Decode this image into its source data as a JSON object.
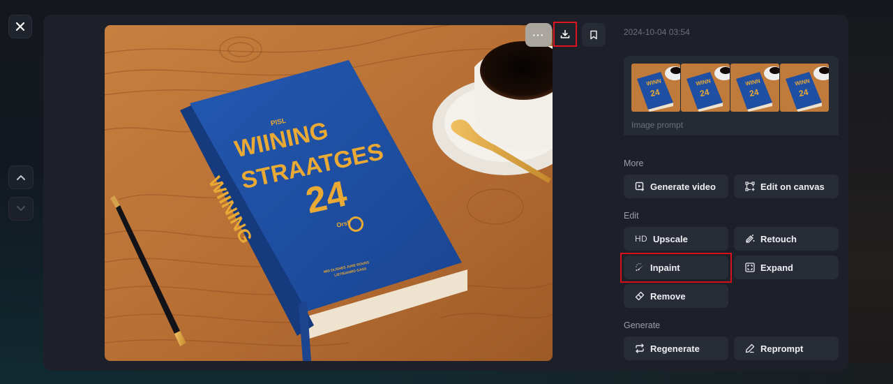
{
  "window": {
    "close_icon": "close-icon",
    "nav_up_icon": "chevron-up-icon",
    "nav_down_icon": "chevron-down-icon"
  },
  "image_toolbar": {
    "more_label": "···",
    "download_icon": "download-icon",
    "bookmark_icon": "bookmark-icon"
  },
  "main_image": {
    "description": "Blue hardcover book on wooden table with coffee cup, gold spoon and black pen",
    "book_title_small": "PISL",
    "book_title_line1": "WIINING",
    "book_title_line2": "STRAATGES",
    "book_title_number": "24",
    "book_subtitle": "Orsfiine",
    "book_footer_line1": "MID DLISHES JUHE ROUNS",
    "book_footer_line2": "LIETIEAHIRD GASS"
  },
  "details": {
    "timestamp": "2024-10-04 03:54",
    "prompt_label": "Image prompt",
    "thumbnails": [
      {
        "name": "variant-1"
      },
      {
        "name": "variant-2"
      },
      {
        "name": "variant-3"
      },
      {
        "name": "variant-4"
      }
    ]
  },
  "sections": {
    "more": {
      "label": "More",
      "buttons": [
        {
          "label": "Generate video",
          "icon": "video-add-icon"
        },
        {
          "label": "Edit on canvas",
          "icon": "canvas-edit-icon"
        }
      ]
    },
    "edit": {
      "label": "Edit",
      "buttons": [
        {
          "label": "Upscale",
          "icon_text": "HD"
        },
        {
          "label": "Retouch",
          "icon": "magic-wand-icon"
        },
        {
          "label": "Inpaint",
          "icon": "brush-icon",
          "highlighted": true
        },
        {
          "label": "Expand",
          "icon": "expand-icon"
        },
        {
          "label": "Remove",
          "icon": "eraser-icon"
        }
      ]
    },
    "generate": {
      "label": "Generate",
      "buttons": [
        {
          "label": "Regenerate",
          "icon": "refresh-icon"
        },
        {
          "label": "Reprompt",
          "icon": "pencil-icon"
        }
      ]
    }
  },
  "colors": {
    "highlight": "#e0141e",
    "panel": "#1d2029",
    "button": "#282c36",
    "book_blue": "#1e4fa0",
    "gold": "#e8a935"
  }
}
